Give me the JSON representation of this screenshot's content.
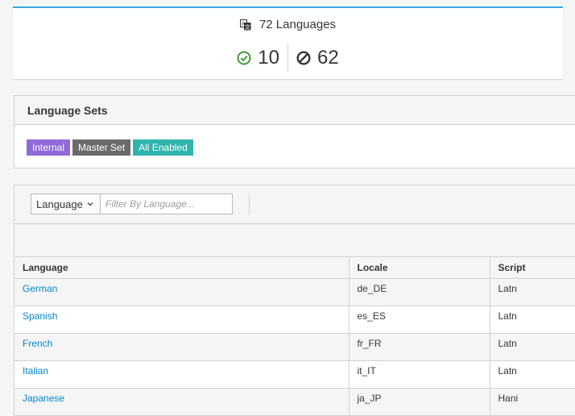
{
  "summary": {
    "title": "72 Languages",
    "enabled_count": "10",
    "disabled_count": "62"
  },
  "language_sets": {
    "header": "Language Sets",
    "badges": [
      {
        "label": "Internal",
        "color": "#8f6ad8"
      },
      {
        "label": "Master Set",
        "color": "#6a6a6a"
      },
      {
        "label": "All Enabled",
        "color": "#2fb5ad"
      }
    ]
  },
  "filter": {
    "select_label": "Language",
    "placeholder": "Filter By Language..."
  },
  "table": {
    "columns": [
      "Language",
      "Locale",
      "Script"
    ],
    "rows": [
      {
        "language": "German",
        "locale": "de_DE",
        "script": "Latn"
      },
      {
        "language": "Spanish",
        "locale": "es_ES",
        "script": "Latn"
      },
      {
        "language": "French",
        "locale": "fr_FR",
        "script": "Latn"
      },
      {
        "language": "Italian",
        "locale": "it_IT",
        "script": "Latn"
      },
      {
        "language": "Japanese",
        "locale": "ja_JP",
        "script": "Hani"
      }
    ]
  },
  "icons": {
    "title": "translate-icon",
    "enabled": "check-circle-icon",
    "disabled": "ban-icon",
    "dropdown": "chevron-down-icon"
  },
  "colors": {
    "accent": "#39a5dc",
    "link": "#0088ce",
    "enabled_icon": "#3f9c35",
    "disabled_icon": "#363636"
  }
}
